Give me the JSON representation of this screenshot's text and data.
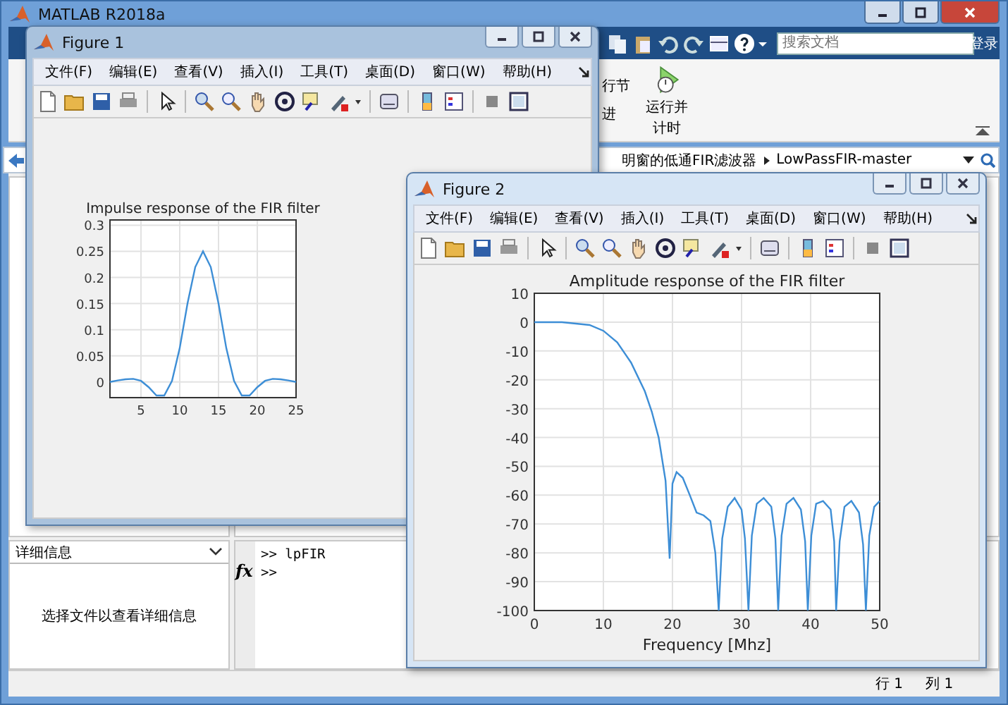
{
  "main_window": {
    "title": "MATLAB R2018a",
    "search": {
      "placeholder": "搜索文档"
    },
    "sign_in": "登录",
    "ribbon": {
      "run_section": "行节",
      "advance": "进",
      "run_and_time": "运行并计时"
    },
    "path": [
      "明窗的低通FIR滤波器",
      "LowPassFIR-master"
    ],
    "details_panel": {
      "title": "详细信息",
      "message": "选择文件以查看详细信息"
    },
    "command_window": {
      "fx": "fx",
      "lines": [
        ">> lpFIR",
        ">>"
      ]
    },
    "status_bar": {
      "row": "行 1",
      "column": "列 1"
    }
  },
  "figures": [
    {
      "title": "Figure 1",
      "active": false,
      "menu": [
        "文件(F)",
        "编辑(E)",
        "查看(V)",
        "插入(I)",
        "工具(T)",
        "桌面(D)",
        "窗口(W)",
        "帮助(H)"
      ],
      "chart_data": {
        "type": "line",
        "title": "Impulse response of the FIR filter",
        "x": [
          1,
          2,
          3,
          4,
          5,
          6,
          7,
          8,
          9,
          10,
          11,
          12,
          13,
          14,
          15,
          16,
          17,
          18,
          19,
          20,
          21,
          22,
          23,
          24,
          25
        ],
        "grid": true,
        "series": [
          {
            "color": "#3d8ed6",
            "values": [
              0,
              0.003,
              0.005,
              0.006,
              0.002,
              -0.01,
              -0.026,
              -0.026,
              0.002,
              0.065,
              0.15,
              0.22,
              0.25,
              0.22,
              0.15,
              0.065,
              0.002,
              -0.026,
              -0.026,
              -0.01,
              0.002,
              0.006,
              0.005,
              0.003,
              0
            ]
          }
        ],
        "xlim": [
          1,
          25
        ],
        "ylim": [
          -0.03,
          0.31
        ],
        "xticks": [
          5,
          10,
          15,
          20,
          25
        ],
        "yticks": [
          0,
          0.05,
          0.1,
          0.15,
          0.2,
          0.25,
          0.3
        ]
      }
    },
    {
      "title": "Figure 2",
      "active": true,
      "menu": [
        "文件(F)",
        "编辑(E)",
        "查看(V)",
        "插入(I)",
        "工具(T)",
        "桌面(D)",
        "窗口(W)",
        "帮助(H)"
      ],
      "chart_data": {
        "type": "line",
        "title": "Amplitude response of the FIR filter",
        "xlabel": "Frequency [Mhz]",
        "x": [
          0,
          4,
          8,
          10,
          12,
          14,
          16,
          17,
          18,
          19,
          19.6,
          20,
          20.6,
          21.5,
          22.5,
          23.5,
          24.5,
          25.5,
          26.2,
          26.7,
          27.2,
          28,
          29,
          30,
          30.5,
          31,
          31.5,
          32.2,
          33.2,
          34.3,
          34.9,
          35.3,
          35.8,
          36.5,
          37.5,
          38.6,
          39.2,
          39.6,
          40.1,
          40.8,
          41.8,
          42.9,
          43.4,
          43.7,
          44.2,
          44.9,
          45.9,
          47,
          47.6,
          48,
          48.5,
          49.2,
          50
        ],
        "grid": true,
        "series": [
          {
            "color": "#3d8ed6",
            "values": [
              0,
              0,
              -1,
              -3,
              -7,
              -14,
              -24,
              -31,
              -40,
              -55,
              -82,
              -56,
              -52,
              -54,
              -60,
              -66,
              -67,
              -69,
              -80,
              -100,
              -75,
              -64,
              -61,
              -65,
              -75,
              -100,
              -74,
              -63,
              -61,
              -64,
              -75,
              -100,
              -74,
              -63,
              -61,
              -65,
              -76,
              -100,
              -74,
              -63,
              -62,
              -65,
              -76,
              -100,
              -76,
              -64,
              -62,
              -66,
              -77,
              -100,
              -74,
              -64,
              -62
            ]
          }
        ],
        "xlim": [
          0,
          50
        ],
        "ylim": [
          -100,
          10
        ],
        "xticks": [
          0,
          10,
          20,
          30,
          40,
          50
        ],
        "yticks": [
          -100,
          -90,
          -80,
          -70,
          -60,
          -50,
          -40,
          -30,
          -20,
          -10,
          0,
          10
        ]
      }
    }
  ]
}
